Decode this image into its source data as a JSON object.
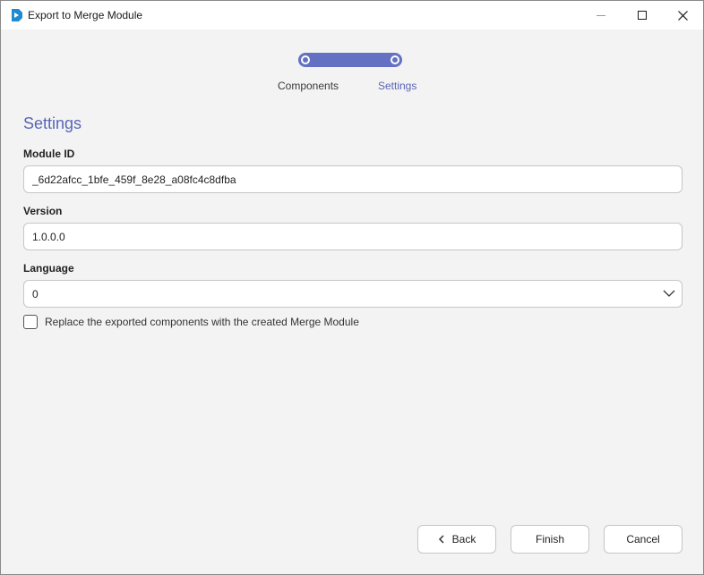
{
  "window": {
    "title": "Export to Merge Module"
  },
  "stepper": {
    "steps": [
      {
        "label": "Components"
      },
      {
        "label": "Settings"
      }
    ],
    "active_index": 1
  },
  "section": {
    "title": "Settings"
  },
  "fields": {
    "module_id": {
      "label": "Module ID",
      "value": "_6d22afcc_1bfe_459f_8e28_a08fc4c8dfba"
    },
    "version": {
      "label": "Version",
      "value": "1.0.0.0"
    },
    "language": {
      "label": "Language",
      "value": "0"
    }
  },
  "replace_checkbox": {
    "label": "Replace the exported components with the created Merge Module",
    "checked": false
  },
  "buttons": {
    "back": "Back",
    "finish": "Finish",
    "cancel": "Cancel"
  },
  "icons": {
    "app": "merge-module-app-icon",
    "minimize": "minimize-icon",
    "maximize": "maximize-icon",
    "close": "close-icon",
    "select": "chevron-down-icon",
    "back": "chevron-left-icon"
  },
  "colors": {
    "accent": "#5965b8",
    "step_track": "#6470c2",
    "app_icon": "#1f8ad1"
  }
}
